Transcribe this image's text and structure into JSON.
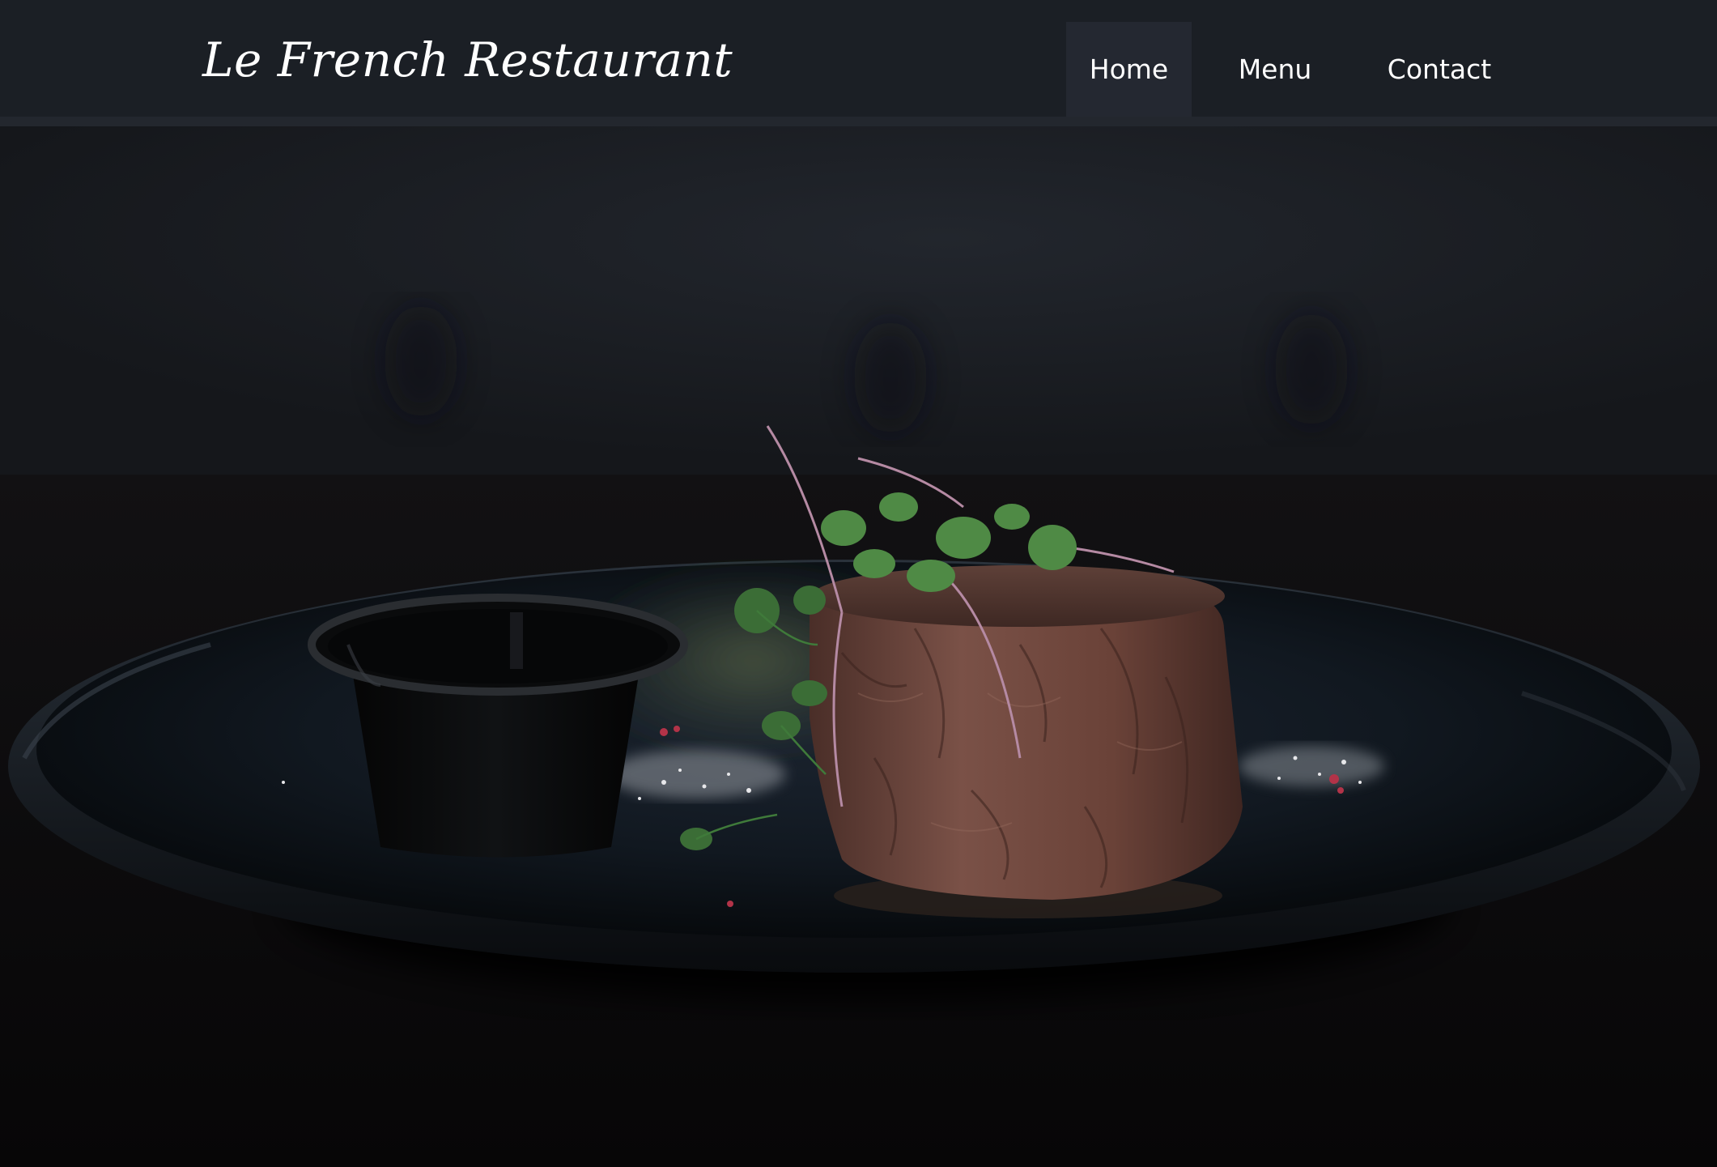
{
  "brand": {
    "name": "Le French Restaurant"
  },
  "nav": {
    "items": [
      {
        "label": "Home",
        "active": true
      },
      {
        "label": "Menu",
        "active": false
      },
      {
        "label": "Contact",
        "active": false
      }
    ]
  },
  "colors": {
    "navbar_bg": "#1b1f25",
    "active_nav_bg": "#242831",
    "text": "#ffffff"
  }
}
